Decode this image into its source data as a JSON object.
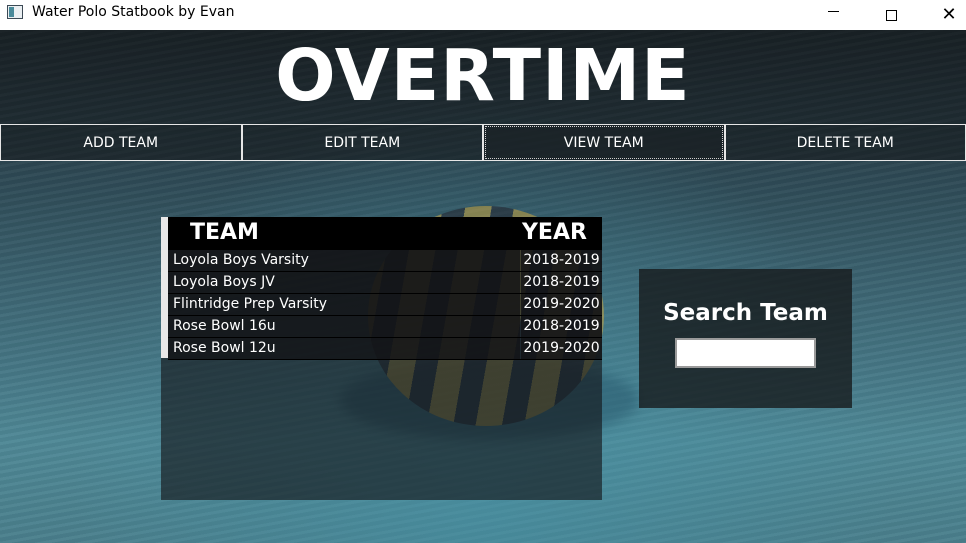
{
  "window": {
    "title": "Water Polo Statbook by Evan",
    "controls": {
      "minimize": "",
      "maximize": "",
      "close": "✕"
    }
  },
  "header": {
    "title": "OVERTIME"
  },
  "nav": {
    "add": "ADD TEAM",
    "edit": "EDIT TEAM",
    "view": "VIEW TEAM",
    "delete": "DELETE TEAM",
    "active": "VIEW TEAM"
  },
  "table": {
    "headers": {
      "team": "TEAM",
      "year": "YEAR"
    },
    "rows": [
      {
        "team": "Loyola Boys Varsity",
        "year": "2018-2019"
      },
      {
        "team": "Loyola Boys JV",
        "year": "2018-2019"
      },
      {
        "team": "Flintridge Prep Varsity",
        "year": "2019-2020"
      },
      {
        "team": "Rose Bowl 16u",
        "year": "2018-2019"
      },
      {
        "team": "Rose Bowl 12u",
        "year": "2019-2020"
      }
    ]
  },
  "search": {
    "label": "Search Team",
    "value": ""
  }
}
